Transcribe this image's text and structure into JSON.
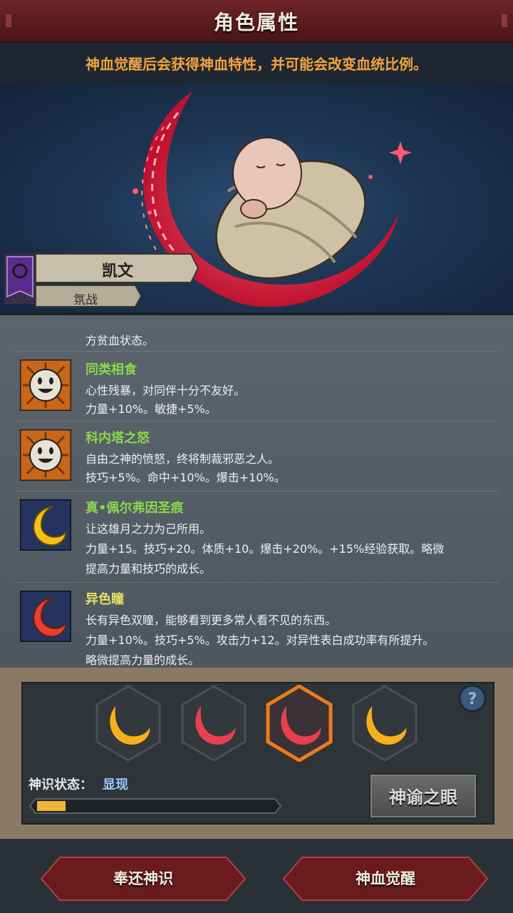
{
  "header": {
    "title": "角色属性"
  },
  "notice": "神血觉醒后会获得神血特性，并可能会改变血统比例。",
  "character": {
    "name": "凯文",
    "trait_tag": "氛战"
  },
  "traits": [
    {
      "name": "",
      "icon": "red-crescent-icon",
      "lines": [
        "",
        "方贫血状态。"
      ]
    },
    {
      "name": "同类相食",
      "icon": "smiley-face-icon",
      "lines": [
        "心性残暴，对同伴十分不友好。",
        "力量+10%。敏捷+5%。"
      ]
    },
    {
      "name": "科内塔之怒",
      "icon": "smiley-face-icon",
      "lines": [
        "自由之神的愤怒，终将制裁邪恶之人。",
        "技巧+5%。命中+10%。爆击+10%。"
      ]
    },
    {
      "name": "真•佩尔弗因圣痕",
      "icon": "golden-crescent-icon",
      "lines": [
        "让这雄月之力为己所用。",
        "力量+15。技巧+20。体质+10。爆击+20%。+15%经验获取。略微",
        "提高力量和技巧的成长。"
      ]
    },
    {
      "name": "异色瞳",
      "icon": "red-crescent-icon",
      "lines": [
        "长有异色双瞳，能够看到更多常人看不见的东西。",
        "力量+10%。技巧+5%。攻击力+12。对异性表白成功率有所提升。",
        "略微提高力量的成长。"
      ]
    }
  ],
  "gems": [
    {
      "type": "gold",
      "selected": false
    },
    {
      "type": "red",
      "selected": false
    },
    {
      "type": "red",
      "selected": true
    },
    {
      "type": "gold",
      "selected": false
    }
  ],
  "status": {
    "label": "神识状态：",
    "value": "显现",
    "progress": 0.12
  },
  "buttons": {
    "eye": "神谕之眼",
    "return": "奉还神识",
    "awaken": "神血觉醒"
  },
  "colors": {
    "accent_orange": "#f3a33d",
    "trait_green": "#8bd64a",
    "status_blue": "#9ec7ff",
    "header_red": "#6e2424"
  }
}
